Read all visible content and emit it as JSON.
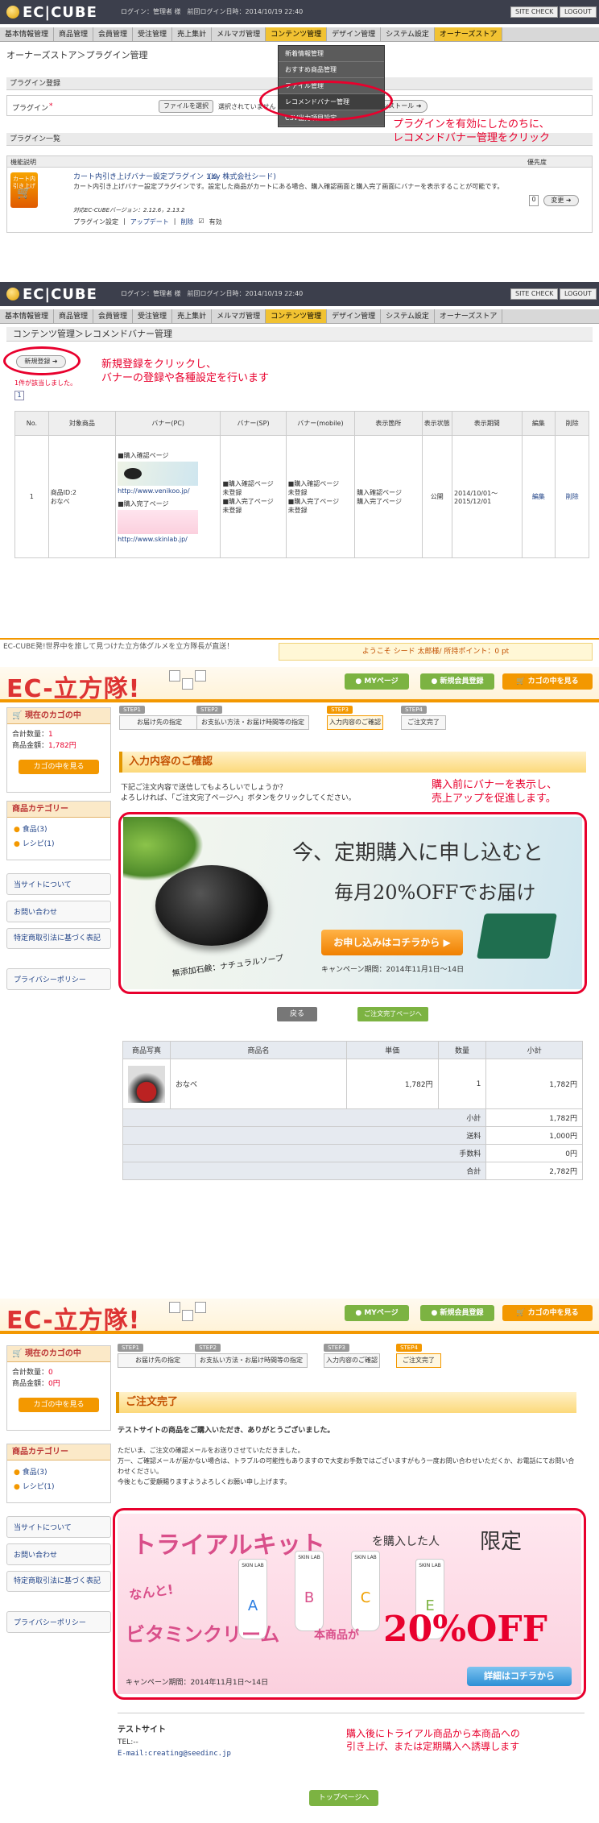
{
  "admin1": {
    "logo": "EC|CUBE",
    "login_info": "ログイン：管理者 様　前回ログイン日時：2014/10/19 22:40",
    "site_check": "SITE CHECK",
    "logout": "LOGOUT",
    "nav": [
      "基本情報管理",
      "商品管理",
      "会員管理",
      "受注管理",
      "売上集計",
      "メルマガ管理",
      "コンテンツ管理",
      "デザイン管理",
      "システム設定",
      "オーナーズストア"
    ],
    "breadcrumb": "オーナーズストア＞プラグイン管理",
    "dropdown": [
      "新着情報管理",
      "おすすめ商品管理",
      "ファイル管理",
      "レコメンドバナー管理",
      "CSV出力項目設定"
    ],
    "section_register": "プラグイン登録",
    "plugin_label": "プラグイン",
    "file_button": "ファイルを選択",
    "file_status": "選択されていません",
    "install_button": "インストール",
    "section_list": "プラグイン一覧",
    "col_desc": "機能説明",
    "col_priority": "優先度",
    "plugin_icon_text": "カート内引き上げ",
    "plugin_name": "カート内引き上げバナー設定プラグイン 1.0",
    "plugin_by": "(by 株式会社シード)",
    "plugin_desc": "カート内引き上げバナー設定プラグインです。設定した商品がカートにある場合、購入確認画面と購入完了画面にバナーを表示することが可能です。",
    "plugin_version": "対応EC-CUBEバージョン：2.12.6，2.13.2",
    "plugin_links": [
      "プラグイン設定",
      "アップデート",
      "削除"
    ],
    "enable_label": "有効",
    "priority_value": "0",
    "change_button": "変更",
    "annotation": "プラグインを有効にしたのちに、\nレコメンドバナー管理をクリック"
  },
  "admin2": {
    "logo": "EC|CUBE",
    "login_info": "ログイン：管理者 様　前回ログイン日時：2014/10/19 22:40",
    "site_check": "SITE CHECK",
    "logout": "LOGOUT",
    "nav": [
      "基本情報管理",
      "商品管理",
      "会員管理",
      "受注管理",
      "売上集計",
      "メルマガ管理",
      "コンテンツ管理",
      "デザイン管理",
      "システム設定",
      "オーナーズストア"
    ],
    "breadcrumb": "コンテンツ管理＞レコメンドバナー管理",
    "new_button": "新規登録",
    "result_count": "1件が該当しました。",
    "page_number": "1",
    "annotation": "新規登録をクリックし、\nバナーの登録や各種設定を行います",
    "table_headers": [
      "No.",
      "対象商品",
      "バナー(PC)",
      "バナー(SP)",
      "バナー(mobile)",
      "表示箇所",
      "表示状態",
      "表示期間",
      "編集",
      "削除"
    ],
    "row": {
      "no": "1",
      "product": "商品ID:2\nおなべ",
      "pc_confirm_title": "■購入確認ページ",
      "pc_confirm_url": "http://www.venikoo.jp/",
      "pc_complete_title": "■購入完了ページ",
      "pc_complete_url": "http://www.skinlab.jp/",
      "sp": "■購入確認ページ\n未登録\n■購入完了ページ\n未登録",
      "mobile": "■購入確認ページ\n未登録\n■購入完了ページ\n未登録",
      "location": "購入確認ページ\n購入完了ページ",
      "status": "公開",
      "period": "2014/10/01〜\n2015/12/01",
      "edit": "編集",
      "delete": "削除"
    }
  },
  "shop1": {
    "tagline": "EC-CUBE発!世界中を旅して見つけた立方体グルメを立方隊長が直送！",
    "welcome": "ようこそ シード 太郎様/ 所持ポイント：0 pt",
    "logo": "EC-立方隊!",
    "tabs": [
      "MYページ",
      "新規会員登録",
      "カゴの中を見る"
    ],
    "cart_title": "現在のカゴの中",
    "cart_qty_label": "合計数量：",
    "cart_qty": "1",
    "cart_amount_label": "商品金額：",
    "cart_amount": "1,782円",
    "cart_button": "カゴの中を見る",
    "category_title": "商品カテゴリー",
    "categories": [
      "食品(3)",
      "レシピ(1)"
    ],
    "side_links": [
      "当サイトについて",
      "お問い合わせ",
      "特定商取引法に基づく表記",
      "プライバシーポリシー"
    ],
    "steps": [
      {
        "num": "STEP1",
        "label": "お届け先の指定"
      },
      {
        "num": "STEP2",
        "label": "お支払い方法・お届け時間等の指定"
      },
      {
        "num": "STEP3",
        "label": "入力内容のご確認"
      },
      {
        "num": "STEP4",
        "label": "ご注文完了"
      }
    ],
    "heading": "入力内容のご確認",
    "intro": "下記ご注文内容で送信してもよろしいでしょうか？\nよろしければ、「ご注文完了ページへ」ボタンをクリックしてください。",
    "annotation": "購入前にバナーを表示し、\n売上アップを促進します。",
    "banner_line1": "今、定期購入に申し込むと",
    "banner_line2": "毎月20%OFFでお届け",
    "banner_product": "無添加石鹸：ナチュラルソープ",
    "banner_button": "お申し込みはコチラから",
    "banner_period": "キャンペーン期間：2014年11月1日〜14日",
    "back_button": "戻る",
    "next_button": "ご注文完了ページへ",
    "table_headers": [
      "商品写真",
      "商品名",
      "単価",
      "数量",
      "小計"
    ],
    "item": {
      "name": "おなべ",
      "price": "1,782円",
      "qty": "1",
      "subtotal": "1,782円"
    },
    "totals": [
      {
        "label": "小計",
        "value": "1,782円"
      },
      {
        "label": "送料",
        "value": "1,000円"
      },
      {
        "label": "手数料",
        "value": "0円"
      },
      {
        "label": "合計",
        "value": "2,782円"
      }
    ]
  },
  "shop2": {
    "logo": "EC-立方隊!",
    "tabs": [
      "MYページ",
      "新規会員登録",
      "カゴの中を見る"
    ],
    "cart_title": "現在のカゴの中",
    "cart_qty_label": "合計数量：",
    "cart_qty": "0",
    "cart_amount_label": "商品金額：",
    "cart_amount": "0円",
    "cart_button": "カゴの中を見る",
    "category_title": "商品カテゴリー",
    "categories": [
      "食品(3)",
      "レシピ(1)"
    ],
    "side_links": [
      "当サイトについて",
      "お問い合わせ",
      "特定商取引法に基づく表記",
      "プライバシーポリシー"
    ],
    "steps": [
      {
        "num": "STEP1",
        "label": "お届け先の指定"
      },
      {
        "num": "STEP2",
        "label": "お支払い方法・お届け時間等の指定"
      },
      {
        "num": "STEP3",
        "label": "入力内容のご確認"
      },
      {
        "num": "STEP4",
        "label": "ご注文完了"
      }
    ],
    "heading": "ご注文完了",
    "thanks": "テストサイトの商品をご購入いただき、ありがとうございました。",
    "message": "ただいま、ご注文の確認メールをお送りさせていただきました。\n万一、ご確認メールが届かない場合は、トラブルの可能性もありますので大変お手数ではございますがもう一度お問い合わせいただくか、お電話にてお問い合わせください。\n今後ともご愛顧賜りますようよろしくお願い申し上げます。",
    "banner_title1": "トライアルキット",
    "banner_title2": "を購入した人",
    "banner_title3": "限定",
    "banner_nanto": "なんと!",
    "banner_line2a": "ビタミンクリーム",
    "banner_line2b": "本商品が",
    "banner_percent": "20%OFF",
    "banner_button": "詳細はコチラから",
    "banner_period": "キャンペーン期間：2014年11月1日〜14日",
    "tube_text": "SKIN LAB",
    "tube_letters": [
      "A",
      "B",
      "C",
      "E"
    ],
    "shop_name": "テストサイト",
    "tel": "TEL:--",
    "email": "E-mail:creating@seedinc.jp",
    "top_button": "トップページへ",
    "annotation": "購入後にトライアル商品から本商品への\n引き上げ、または定期購入へ誘導します"
  },
  "colors": {
    "accent_red": "#e8002d",
    "admin_header": "#3c3f4c",
    "active_nav": "#f1c232",
    "shop_orange": "#f39800",
    "shop_green": "#7cb342"
  }
}
